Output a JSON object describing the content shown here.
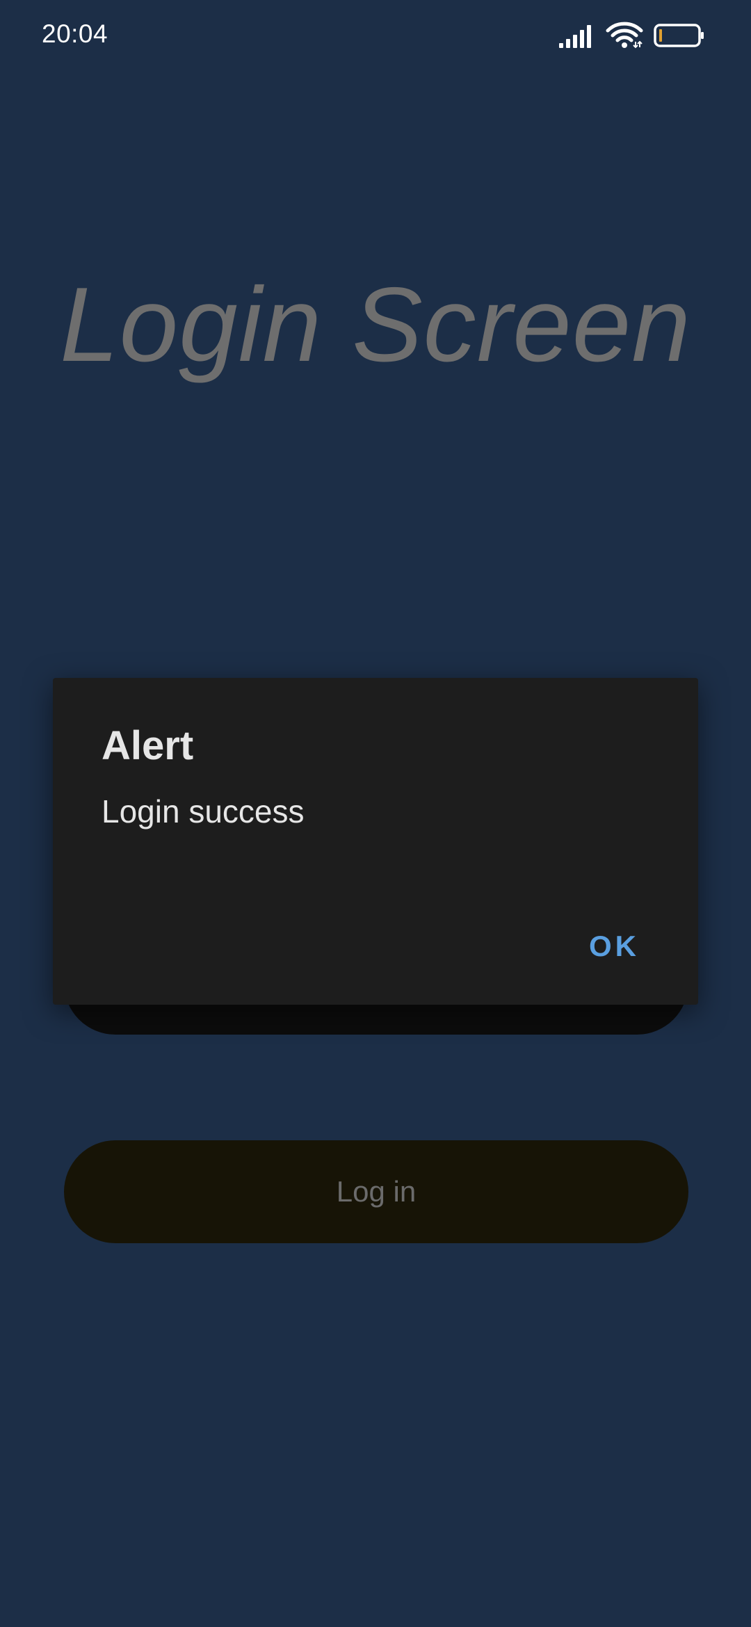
{
  "status_bar": {
    "time": "20:04",
    "icons": [
      "signal-icon",
      "wifi-icon",
      "battery-icon"
    ]
  },
  "screen": {
    "title": "Login Screen",
    "login_button_label": "Log in"
  },
  "dialog": {
    "title": "Alert",
    "message": "Login success",
    "ok_label": "OK"
  },
  "colors": {
    "background": "#1c2e47",
    "dialog_bg": "#1d1d1d",
    "accent": "#5a9fe0",
    "battery_level": "#e0a030"
  }
}
